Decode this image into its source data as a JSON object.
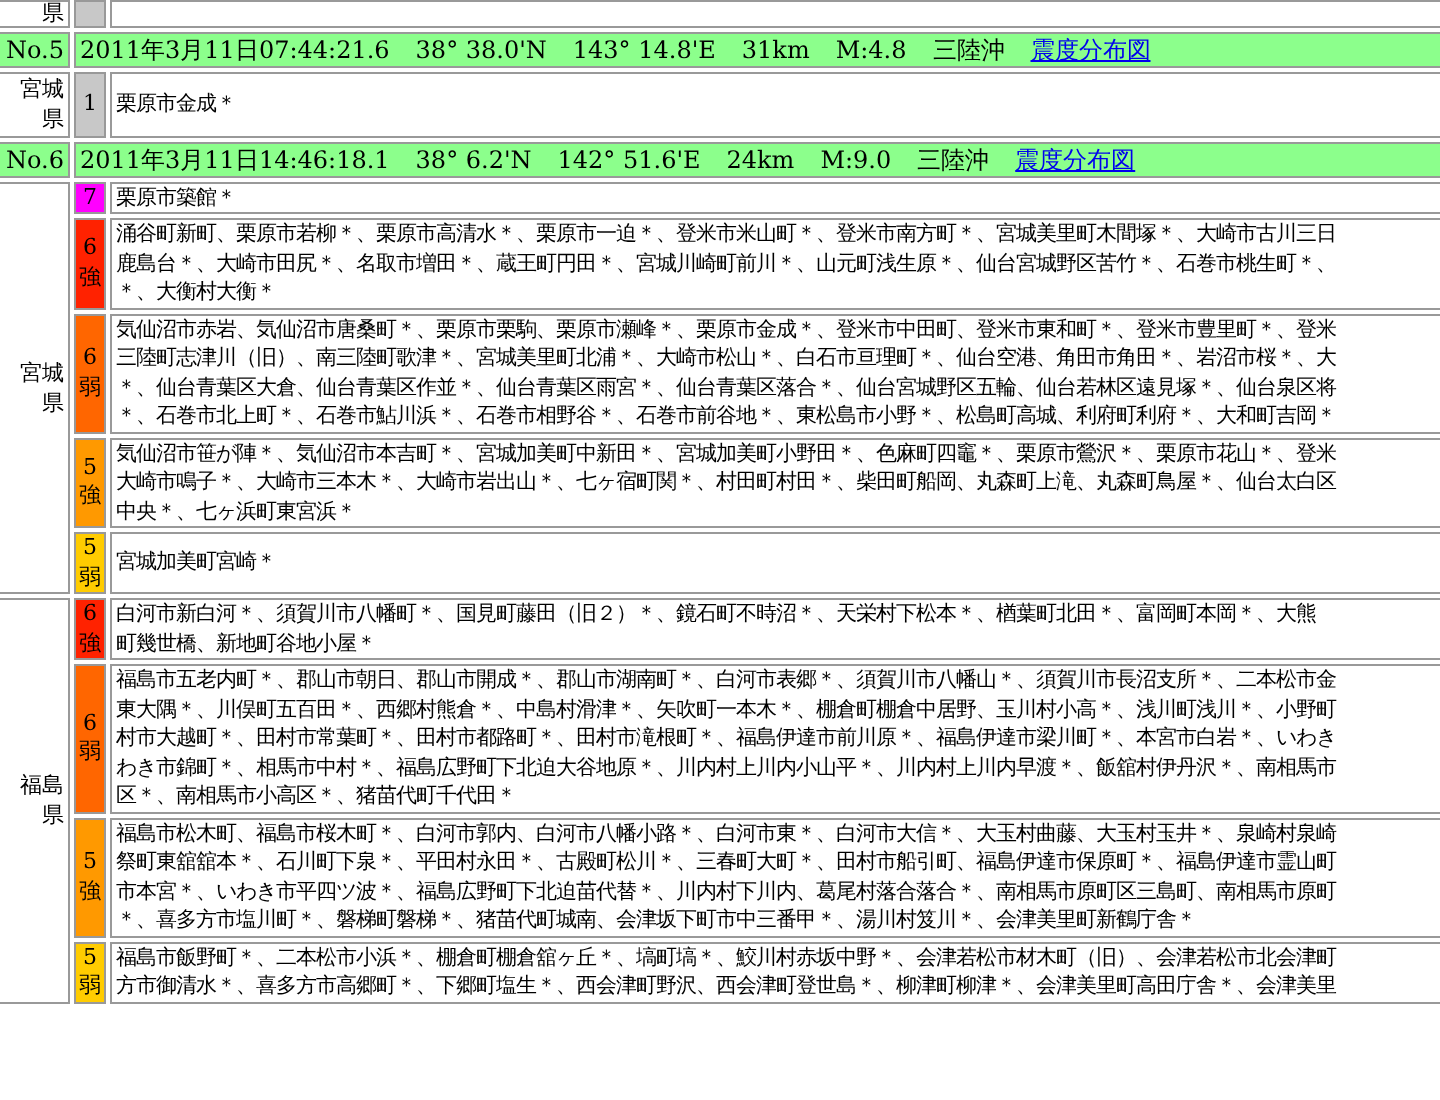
{
  "prev_fragment": {
    "prefecture": "県"
  },
  "events": [
    {
      "no": "No.5",
      "datetime": "2011年3月11日07:44:21.6",
      "latitude": "38° 38.0'N",
      "longitude": "143° 14.8'E",
      "depth": "31km",
      "magnitude": "M:4.8",
      "region": "三陸沖",
      "link": "震度分布図",
      "prefectures": [
        {
          "name": "宮城県",
          "levels": [
            {
              "label": "1",
              "color": "#c8c8c8",
              "lines": [
                "栗原市金成＊"
              ]
            }
          ]
        }
      ]
    },
    {
      "no": "No.6",
      "datetime": "2011年3月11日14:46:18.1",
      "latitude": "38° 6.2'N",
      "longitude": "142° 51.6'E",
      "depth": "24km",
      "magnitude": "M:9.0",
      "region": "三陸沖",
      "link": "震度分布図",
      "prefectures": [
        {
          "name": "宮城県",
          "levels": [
            {
              "label": "7",
              "color": "#ff00ff",
              "lines": [
                "栗原市築館＊"
              ]
            },
            {
              "label": "6強",
              "color": "#ff2200",
              "lines": [
                "涌谷町新町、栗原市若柳＊、栗原市高清水＊、栗原市一迫＊、登米市米山町＊、登米市南方町＊、宮城美里町木間塚＊、大崎市古川三日",
                "鹿島台＊、大崎市田尻＊、名取市増田＊、蔵王町円田＊、宮城川崎町前川＊、山元町浅生原＊、仙台宮城野区苦竹＊、石巻市桃生町＊、",
                "＊、大衡村大衡＊"
              ]
            },
            {
              "label": "6弱",
              "color": "#ff6600",
              "lines": [
                "気仙沼市赤岩、気仙沼市唐桑町＊、栗原市栗駒、栗原市瀬峰＊、栗原市金成＊、登米市中田町、登米市東和町＊、登米市豊里町＊、登米",
                "三陸町志津川（旧）、南三陸町歌津＊、宮城美里町北浦＊、大崎市松山＊、白石市亘理町＊、仙台空港、角田市角田＊、岩沼市桜＊、大",
                "＊、仙台青葉区大倉、仙台青葉区作並＊、仙台青葉区雨宮＊、仙台青葉区落合＊、仙台宮城野区五輪、仙台若林区遠見塚＊、仙台泉区将",
                "＊、石巻市北上町＊、石巻市鮎川浜＊、石巻市相野谷＊、石巻市前谷地＊、東松島市小野＊、松島町高城、利府町利府＊、大和町吉岡＊"
              ]
            },
            {
              "label": "5強",
              "color": "#ff9900",
              "lines": [
                "気仙沼市笹が陣＊、気仙沼市本吉町＊、宮城加美町中新田＊、宮城加美町小野田＊、色麻町四竈＊、栗原市鶯沢＊、栗原市花山＊、登米",
                "大崎市鳴子＊、大崎市三本木＊、大崎市岩出山＊、七ヶ宿町関＊、村田町村田＊、柴田町船岡、丸森町上滝、丸森町鳥屋＊、仙台太白区",
                "中央＊、七ヶ浜町東宮浜＊"
              ]
            },
            {
              "label": "5弱",
              "color": "#ffcc00",
              "lines": [
                "宮城加美町宮崎＊"
              ]
            }
          ]
        },
        {
          "name": "福島県",
          "levels": [
            {
              "label": "6強",
              "color": "#ff2200",
              "lines": [
                "白河市新白河＊、須賀川市八幡町＊、国見町藤田（旧２）＊、鏡石町不時沼＊、天栄村下松本＊、楢葉町北田＊、富岡町本岡＊、大熊",
                "町幾世橋、新地町谷地小屋＊"
              ]
            },
            {
              "label": "6弱",
              "color": "#ff6600",
              "lines": [
                "福島市五老内町＊、郡山市朝日、郡山市開成＊、郡山市湖南町＊、白河市表郷＊、須賀川市八幡山＊、須賀川市長沼支所＊、二本松市金",
                "東大隅＊、川俣町五百田＊、西郷村熊倉＊、中島村滑津＊、矢吹町一本木＊、棚倉町棚倉中居野、玉川村小高＊、浅川町浅川＊、小野町",
                "村市大越町＊、田村市常葉町＊、田村市都路町＊、田村市滝根町＊、福島伊達市前川原＊、福島伊達市梁川町＊、本宮市白岩＊、いわき",
                "わき市錦町＊、相馬市中村＊、福島広野町下北迫大谷地原＊、川内村上川内小山平＊、川内村上川内早渡＊、飯舘村伊丹沢＊、南相馬市",
                "区＊、南相馬市小高区＊、猪苗代町千代田＊"
              ]
            },
            {
              "label": "5強",
              "color": "#ff9900",
              "lines": [
                "福島市松木町、福島市桜木町＊、白河市郭内、白河市八幡小路＊、白河市東＊、白河市大信＊、大玉村曲藤、大玉村玉井＊、泉崎村泉崎",
                "祭町東舘舘本＊、石川町下泉＊、平田村永田＊、古殿町松川＊、三春町大町＊、田村市船引町、福島伊達市保原町＊、福島伊達市霊山町",
                "市本宮＊、いわき市平四ツ波＊、福島広野町下北迫苗代替＊、川内村下川内、葛尾村落合落合＊、南相馬市原町区三島町、南相馬市原町",
                "＊、喜多方市塩川町＊、磐梯町磐梯＊、猪苗代町城南、会津坂下町市中三番甲＊、湯川村笈川＊、会津美里町新鶴庁舎＊"
              ]
            },
            {
              "label": "5弱",
              "color": "#ffcc00",
              "lines": [
                "福島市飯野町＊、二本松市小浜＊、棚倉町棚倉舘ヶ丘＊、塙町塙＊、鮫川村赤坂中野＊、会津若松市材木町（旧）、会津若松市北会津町",
                "方市御清水＊、喜多方市高郷町＊、下郷町塩生＊、西会津町野沢、西会津町登世島＊、柳津町柳津＊、会津美里町高田庁舎＊、会津美里"
              ]
            }
          ]
        }
      ]
    }
  ]
}
